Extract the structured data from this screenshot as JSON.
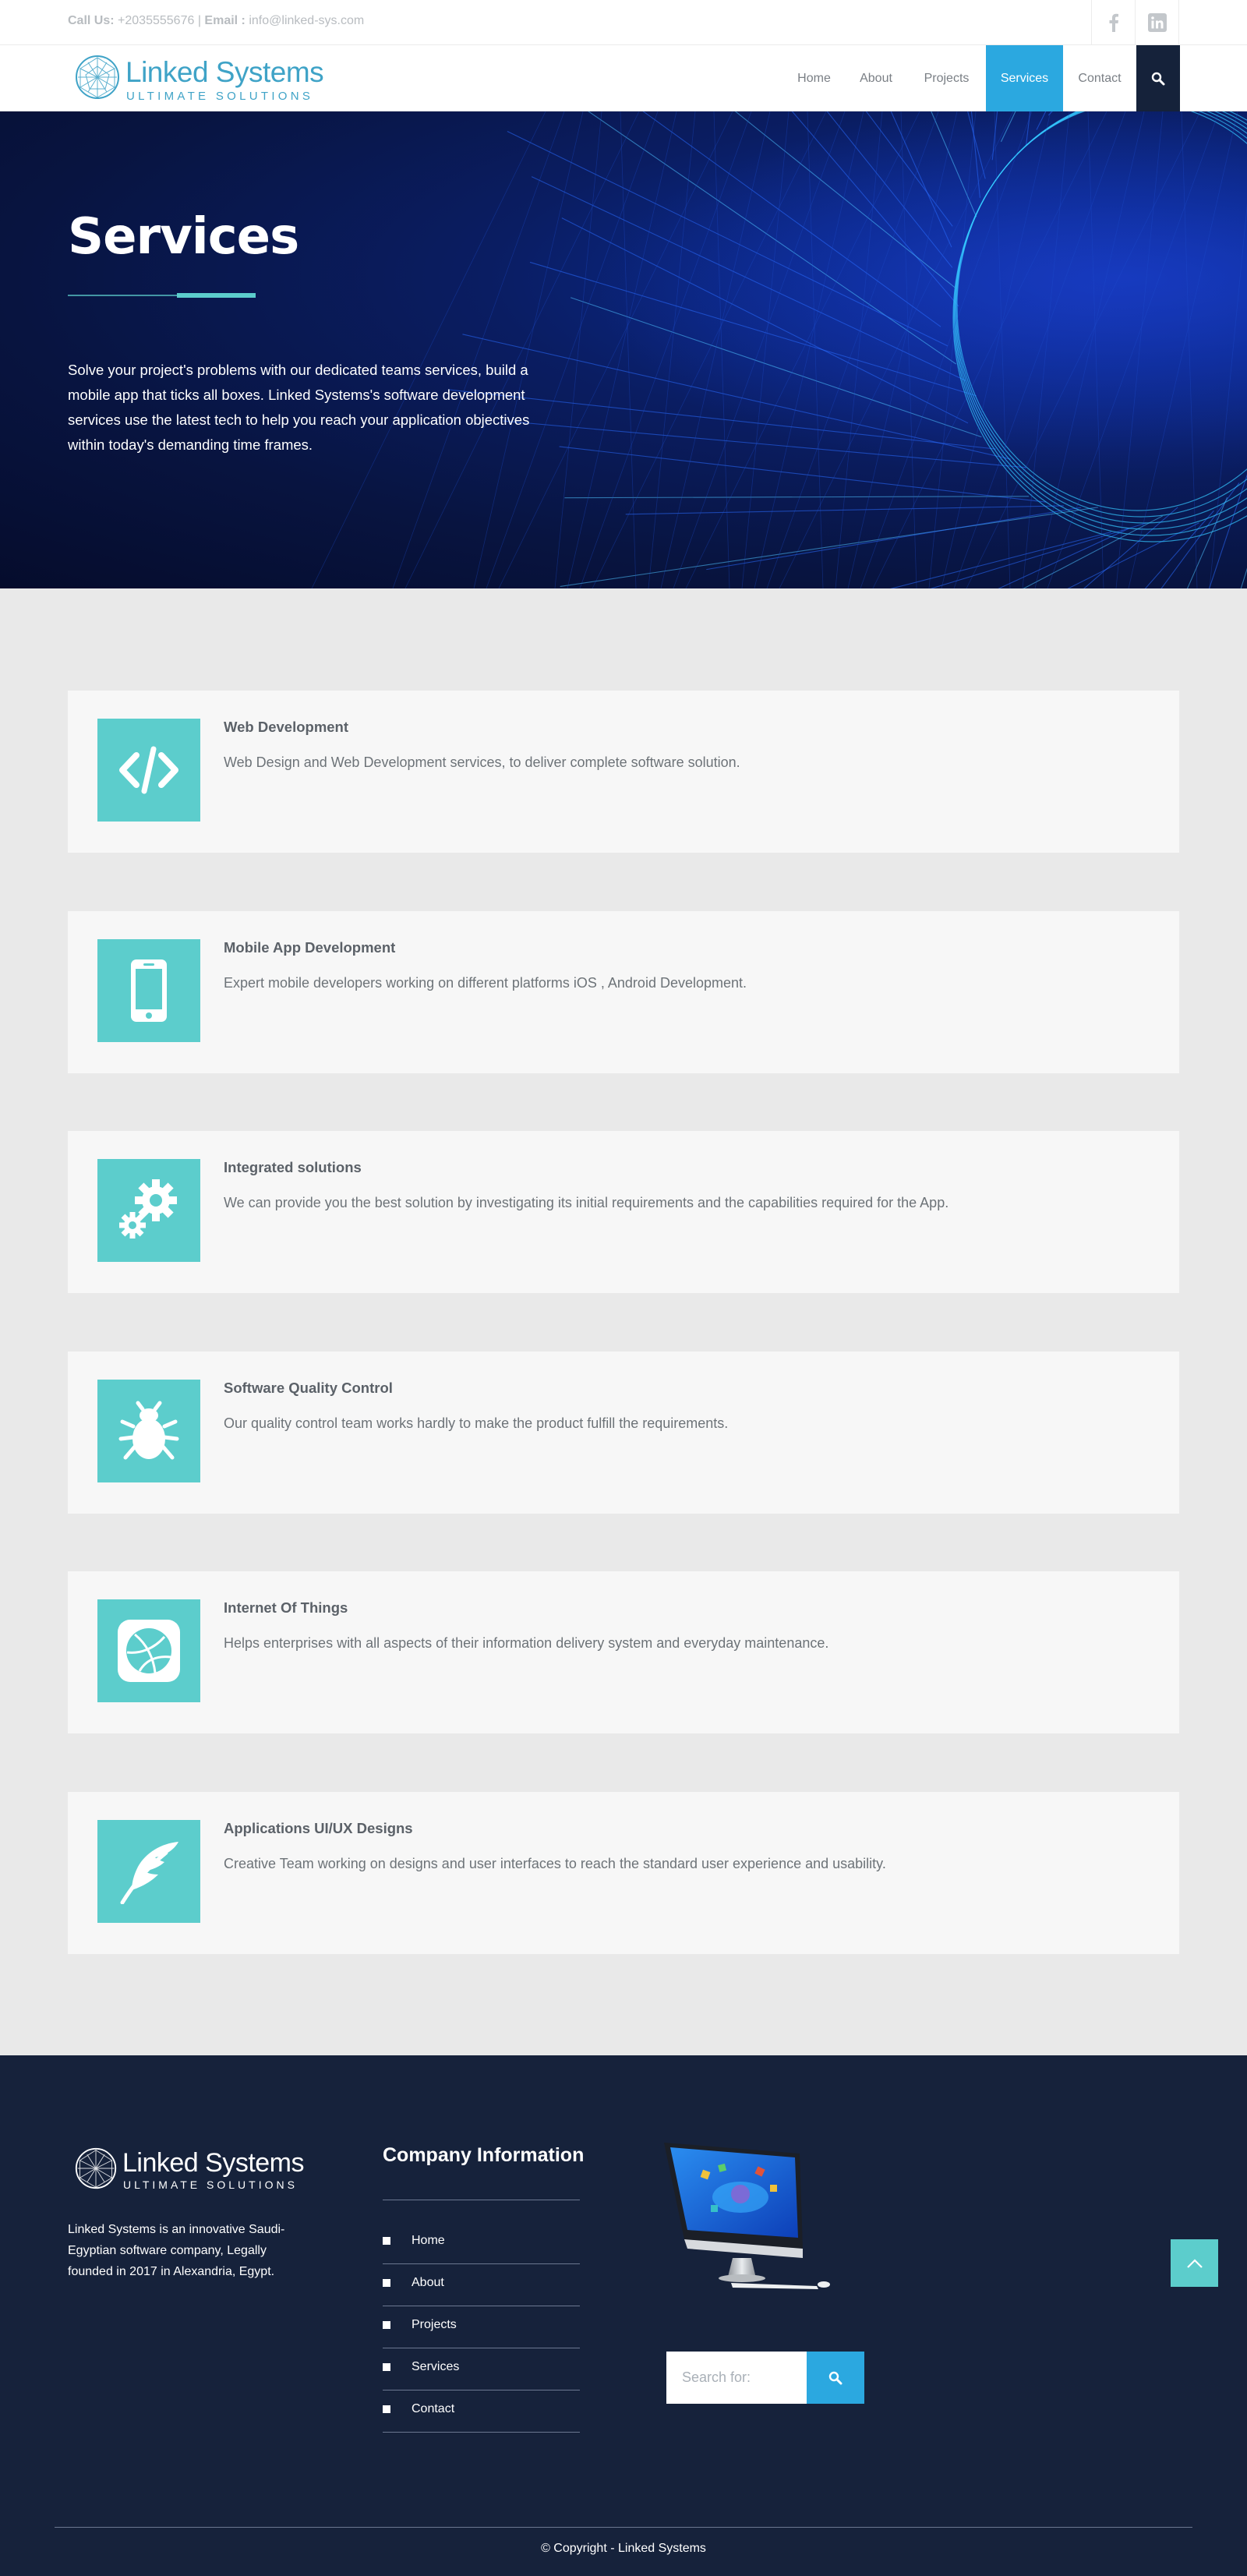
{
  "topbar": {
    "call_label": "Call Us:",
    "phone": "+2035555676",
    "separator": "|",
    "email_label": "Email :",
    "email": "info@linked-sys.com",
    "social": [
      "facebook-icon",
      "linkedin-icon"
    ]
  },
  "header": {
    "brand": "Linked Systems",
    "tagline": "ULTIMATE SOLUTIONS",
    "nav": [
      "Home",
      "About",
      "Projects",
      "Services",
      "Contact"
    ],
    "active_nav": "Services"
  },
  "hero": {
    "title": "Services",
    "description": "Solve your project's problems with our dedicated teams services, build a mobile app that ticks all boxes. Linked Systems's software development services use the latest tech to help you reach your application objectives within today's demanding time frames."
  },
  "services": [
    {
      "title": "Web Development",
      "text": "Web Design and Web Development services, to deliver complete software solution.",
      "icon": "code-icon"
    },
    {
      "title": "Mobile App Development",
      "text": "Expert mobile developers working on different platforms iOS , Android Development.",
      "icon": "mobile-phone-icon"
    },
    {
      "title": "Integrated solutions",
      "text": "We can provide you the best solution by investigating its initial requirements and the capabilities required for the App.",
      "icon": "gears-icon"
    },
    {
      "title": "Software Quality Control",
      "text": "Our quality control team works hardly to make the product fulfill the requirements.",
      "icon": "bug-icon"
    },
    {
      "title": "Internet Of Things",
      "text": "Helps enterprises with all aspects of their information delivery system and everyday maintenance.",
      "icon": "dribbble-icon"
    },
    {
      "title": "Applications UI/UX Designs",
      "text": "Creative Team working on designs and user interfaces to reach the standard user experience and usability.",
      "icon": "feather-icon"
    }
  ],
  "footer": {
    "brand": "Linked Systems",
    "tagline": "ULTIMATE SOLUTIONS",
    "about": "Linked Systems is an innovative Saudi-Egyptian software company, Legally founded in 2017 in Alexandria, Egypt.",
    "company_title": "Company Information",
    "links": [
      "Home",
      "About",
      "Projects",
      "Services",
      "Contact"
    ],
    "search_placeholder": "Search for:",
    "copyright": "© Copyright - Linked Systems"
  },
  "colors": {
    "accent_teal": "#5ccdcc",
    "accent_blue": "#2ba8e0",
    "footer_bg": "#16223b",
    "hero_bg": "#081440"
  }
}
